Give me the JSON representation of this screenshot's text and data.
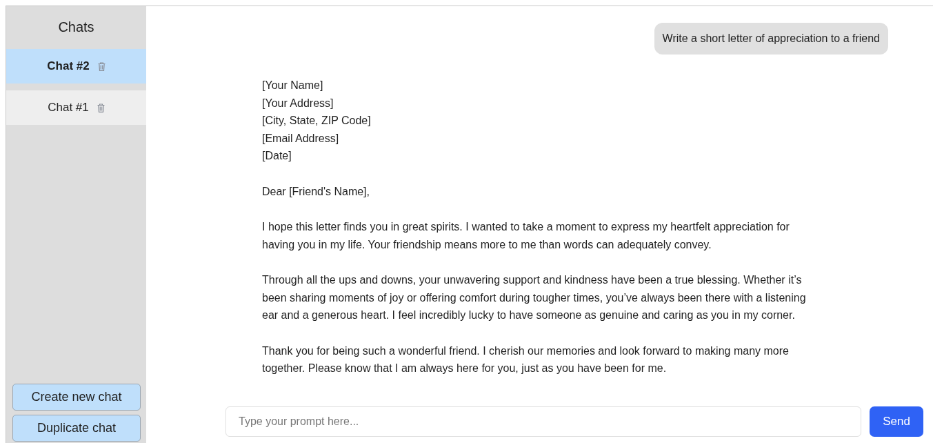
{
  "sidebar": {
    "title": "Chats",
    "chats": [
      {
        "label": "Chat #2",
        "selected": true
      },
      {
        "label": "Chat #1",
        "selected": false
      }
    ],
    "buttons": [
      "Create new chat",
      "Duplicate chat"
    ]
  },
  "messages": [
    {
      "kind": "user",
      "paragraphs": [
        [
          "Write a short letter of appreciation to a friend"
        ]
      ]
    },
    {
      "kind": "assistant",
      "paragraphs": [
        [
          "[Your Name]",
          "[Your Address]",
          "[City, State, ZIP Code]",
          "[Email Address]",
          "[Date]"
        ],
        [
          "Dear [Friend's Name],"
        ],
        [
          "I hope this letter finds you in great spirits. I wanted to take a moment to express my heartfelt appreciation for",
          "having you in my life. Your friendship means more to me than words can adequately convey."
        ],
        [
          "Through all the ups and downs, your unwavering support and kindness have been a true blessing. Whether it’s",
          "been sharing moments of joy or offering comfort during tougher times, you’ve always been there with a listening",
          "ear and a generous heart. I feel incredibly lucky to have someone as genuine and caring as you in my corner."
        ],
        [
          "Thank you for being such a wonderful friend. I cherish our memories and look forward to making many more",
          "together. Please know that I am always here for you, just as you have been for me."
        ]
      ]
    }
  ],
  "composer": {
    "placeholder": "Type your prompt here...",
    "send": "Send"
  }
}
